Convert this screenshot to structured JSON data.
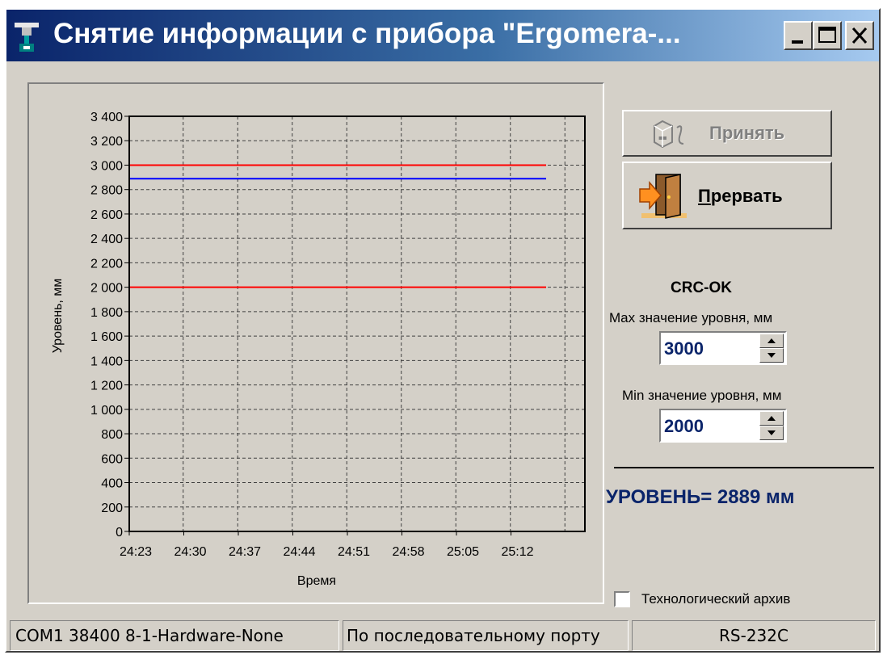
{
  "window": {
    "title": "Снятие информации с прибора \"Ergomera-...",
    "controls": [
      "minimize",
      "maximize",
      "close"
    ]
  },
  "buttons": {
    "accept_label": "Принять",
    "accept_enabled": false,
    "abort_label": "Прервать"
  },
  "crc_status": "CRC-OK",
  "max_level": {
    "label": "Max значение уровня, мм",
    "value": "3000"
  },
  "min_level": {
    "label": "Min значение уровня, мм",
    "value": "2000"
  },
  "level_readout": "УРОВЕНЬ= 2889 мм",
  "tech_archive": {
    "label": "Технологический архив",
    "checked": false
  },
  "statusbar": {
    "port_settings": "COM1 38400 8-1-Hardware-None",
    "connection_mode": "По последовательному порту",
    "interface": "RS-232C"
  },
  "colors": {
    "title_gradient_start": "#0a246a",
    "title_gradient_end": "#a6caf0",
    "limit_line": "#ff0000",
    "level_line": "#0000ff",
    "readout_text": "#0a246a"
  },
  "chart_data": {
    "type": "line",
    "xlabel": "Время",
    "ylabel": "Уровень, мм",
    "categories": [
      "24:23",
      "24:30",
      "24:37",
      "24:44",
      "24:51",
      "24:58",
      "25:05",
      "25:12"
    ],
    "ylim": [
      0,
      3400
    ],
    "yticks": [
      "0",
      "200",
      "400",
      "600",
      "800",
      "1 000",
      "1 200",
      "1 400",
      "1 600",
      "1 800",
      "2 000",
      "2 200",
      "2 400",
      "2 600",
      "2 800",
      "3 000",
      "3 200",
      "3 400"
    ],
    "grid": true,
    "series": [
      {
        "color": "#ff0000",
        "y": 3000
      },
      {
        "color": "#0000ff",
        "y": 2889
      },
      {
        "color": "#ff0000",
        "y": 2000
      }
    ]
  }
}
